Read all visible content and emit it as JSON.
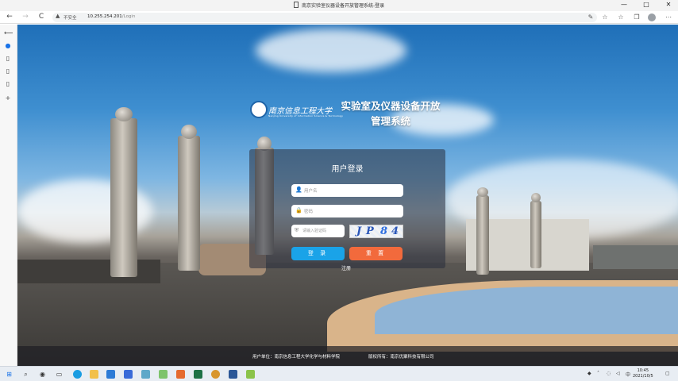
{
  "browser": {
    "tab_title": "南京实验室仪器设备开放管理系统-登录",
    "window_controls": [
      "—",
      "□",
      "✕"
    ],
    "nav": {
      "back": "←",
      "forward": "→",
      "reload": "C"
    },
    "security_label": "不安全",
    "url_host": "10.255.254.201",
    "url_path": "/Login",
    "toolbar_icons": [
      "read-aloud-icon",
      "favorites-icon",
      "collections-icon",
      "profile-icon",
      "more-icon"
    ]
  },
  "sidebar": {
    "items": [
      "back-icon",
      "edge-icon",
      "page-icon",
      "page-icon",
      "page-icon"
    ],
    "add": "+"
  },
  "page": {
    "university_name": "南京信息工程大学",
    "university_en": "Nanjing University of Information Science & Technology",
    "system_title_line1": "实验室及仪器设备开放",
    "system_title_line2": "管理系统",
    "login_title": "用户登录",
    "username_placeholder": "用户名",
    "password_placeholder": "密码",
    "captcha_placeholder": "请输入验证码",
    "captcha_chars": [
      "J",
      "P",
      "8",
      "4"
    ],
    "login_button": "登 录",
    "reset_button": "重 置",
    "register_link": "注册",
    "footer_unit": "用户单位：南京信息工程大学化学与材料学院",
    "footer_copyright": "版权所有：南京优聚科技有限公司"
  },
  "taskbar": {
    "apps": [
      "start-icon",
      "search-icon",
      "task-view-icon",
      "widgets-icon",
      "edge-icon",
      "file-explorer-icon",
      "mail-icon",
      "store-icon",
      "app-l-icon",
      "notepad-icon",
      "app-icon",
      "excel-icon",
      "app-icon",
      "word-icon",
      "app-green-icon"
    ],
    "time": "10:45",
    "date": "2021/10/5"
  }
}
